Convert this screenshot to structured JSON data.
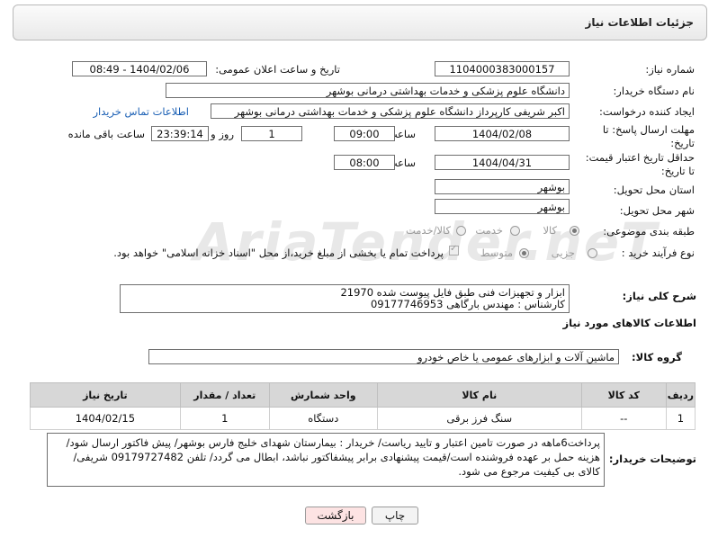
{
  "header": {
    "title": "جزئیات اطلاعات نیاز"
  },
  "form": {
    "need_number_label": "شماره نیاز:",
    "need_number": "1104000383000157",
    "announce_label": "تاریخ و ساعت اعلان عمومی:",
    "announce_value": "1404/02/06 - 08:49",
    "buyer_org_label": "نام دستگاه خریدار:",
    "buyer_org": "دانشگاه علوم پزشکی و خدمات بهداشتی درمانی بوشهر",
    "requester_label": "ایجاد کننده درخواست:",
    "requester": "اکبر شریفی کارپرداز دانشگاه علوم پزشکی و خدمات بهداشتی درمانی بوشهر",
    "buyer_contact_link": "اطلاعات تماس خریدار",
    "reply_deadline_label_1": "مهلت ارسال پاسخ: تا",
    "reply_deadline_label_2": "تاریخ:",
    "reply_date": "1404/02/08",
    "hour_label": "ساعت",
    "reply_time": "09:00",
    "days_value": "1",
    "days_label": "روز و",
    "remaining_time": "23:39:14",
    "remaining_label": "ساعت باقی مانده",
    "price_validity_label_1": "حداقل تاریخ اعتبار قیمت:",
    "price_validity_label_2": "تا تاریخ:",
    "validity_date": "1404/04/31",
    "validity_time": "08:00",
    "province_label": "استان محل تحویل:",
    "province": "بوشهر",
    "city_label": "شهر محل تحویل:",
    "city": "بوشهر",
    "category_label": "طبقه بندی موضوعی:",
    "category_options": [
      "کالا",
      "خدمت",
      "کالا/خدمت"
    ],
    "process_label": "نوع فرآیند خرید :",
    "process_options": [
      "جزیی",
      "متوسط"
    ],
    "payment_note": "پرداخت تمام یا بخشی از مبلغ خرید،از محل \"اسناد خزانه اسلامی\" خواهد بود.",
    "description_label": "شرح کلی نیاز:",
    "description_line1": "ابزار و تجهیزات فنی طبق فایل پیوست شده 21970",
    "description_line2": "کارشناس : مهندس بارگاهی 09177746953"
  },
  "goods": {
    "section_title": "اطلاعات کالاهای مورد نیاز",
    "group_label": "گروه کالا:",
    "group_value": "ماشین آلات و ابزارهای عمومی یا خاص خودرو",
    "columns": [
      "ردیف",
      "کد کالا",
      "نام کالا",
      "واحد شمارش",
      "تعداد / مقدار",
      "تاریخ نیاز"
    ],
    "rows": [
      [
        "1",
        "--",
        "سنگ فرز برقی",
        "دستگاه",
        "1",
        "1404/02/15"
      ]
    ]
  },
  "buyer_notes": {
    "label": "توضیحات خریدار:",
    "line1": "پرداخت6ماهه در صورت تامین اعتبار و تایید ریاست/ خریدار : بیمارستان شهدای خلیج فارس بوشهر/ پیش فاکتور ارسال شود/",
    "line2": "هزینه حمل بر عهده فروشنده است/قیمت پیشنهادی برابر پیشفاکتور نباشد، ابطال می گردد/ تلفن 09179727482 شریفی/",
    "line3": "کالای بی کیفیت مرجوع می شود."
  },
  "buttons": {
    "print": "چاپ",
    "back": "بازگشت"
  },
  "watermark": "AriaTender.neT",
  "colors": {
    "link": "#1a5fb4",
    "back_button_bg": "#fde3e3",
    "table_header": "#d7d7d7"
  }
}
